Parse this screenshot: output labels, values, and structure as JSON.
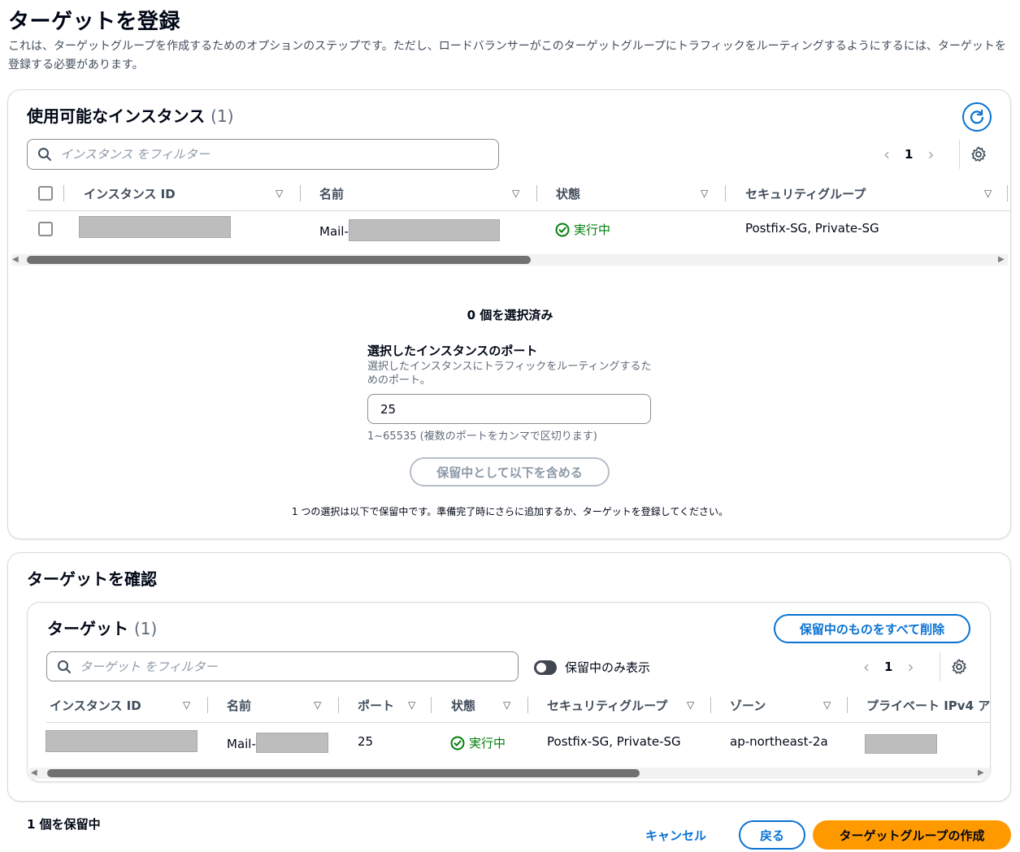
{
  "page": {
    "title": "ターゲットを登録",
    "description": "これは、ターゲットグループを作成するためのオプションのステップです。ただし、ロードバランサーがこのターゲットグループにトラフィックをルーティングするようにするには、ターゲットを登録する必要があります。"
  },
  "available": {
    "heading": "使用可能なインスタンス",
    "count": "(1)",
    "search_placeholder": "インスタンス をフィルター",
    "page_number": "1",
    "columns": [
      "インスタンス ID",
      "名前",
      "状態",
      "セキュリティグループ"
    ],
    "rows": [
      {
        "name_prefix": "Mail-",
        "status": "実行中",
        "security_groups": "Postfix-SG, Private-SG"
      }
    ]
  },
  "selection": {
    "selected_count": "0 個を選択済み",
    "port_label": "選択したインスタンスのポート",
    "port_desc": "選択したインスタンスにトラフィックをルーティングするためのポート。",
    "port_value": "25",
    "port_hint": "1~65535 (複数のポートをカンマで区切ります)",
    "include_button": "保留中として以下を含める",
    "pending_note": "1 つの選択は以下で保留中です。準備完了時にさらに追加するか、ターゲットを登録してください。"
  },
  "review": {
    "heading": "ターゲットを確認",
    "targets_heading": "ターゲット",
    "targets_count": "(1)",
    "remove_all_button": "保留中のものをすべて削除",
    "search_placeholder": "ターゲット をフィルター",
    "toggle_label": "保留中のみ表示",
    "page_number": "1",
    "columns": [
      "インスタンス ID",
      "名前",
      "ポート",
      "状態",
      "セキュリティグループ",
      "ゾーン",
      "プライベート IPv4 ア"
    ],
    "rows": [
      {
        "name_prefix": "Mail-",
        "port": "25",
        "status": "実行中",
        "security_groups": "Postfix-SG, Private-SG",
        "zone": "ap-northeast-2a"
      }
    ]
  },
  "footer": {
    "pending_count": "1 個を保留中",
    "cancel": "キャンセル",
    "back": "戻る",
    "create": "ターゲットグループの作成"
  },
  "colors": {
    "primary": "#ff9900",
    "link": "#0972d3",
    "success": "#037f0c"
  }
}
